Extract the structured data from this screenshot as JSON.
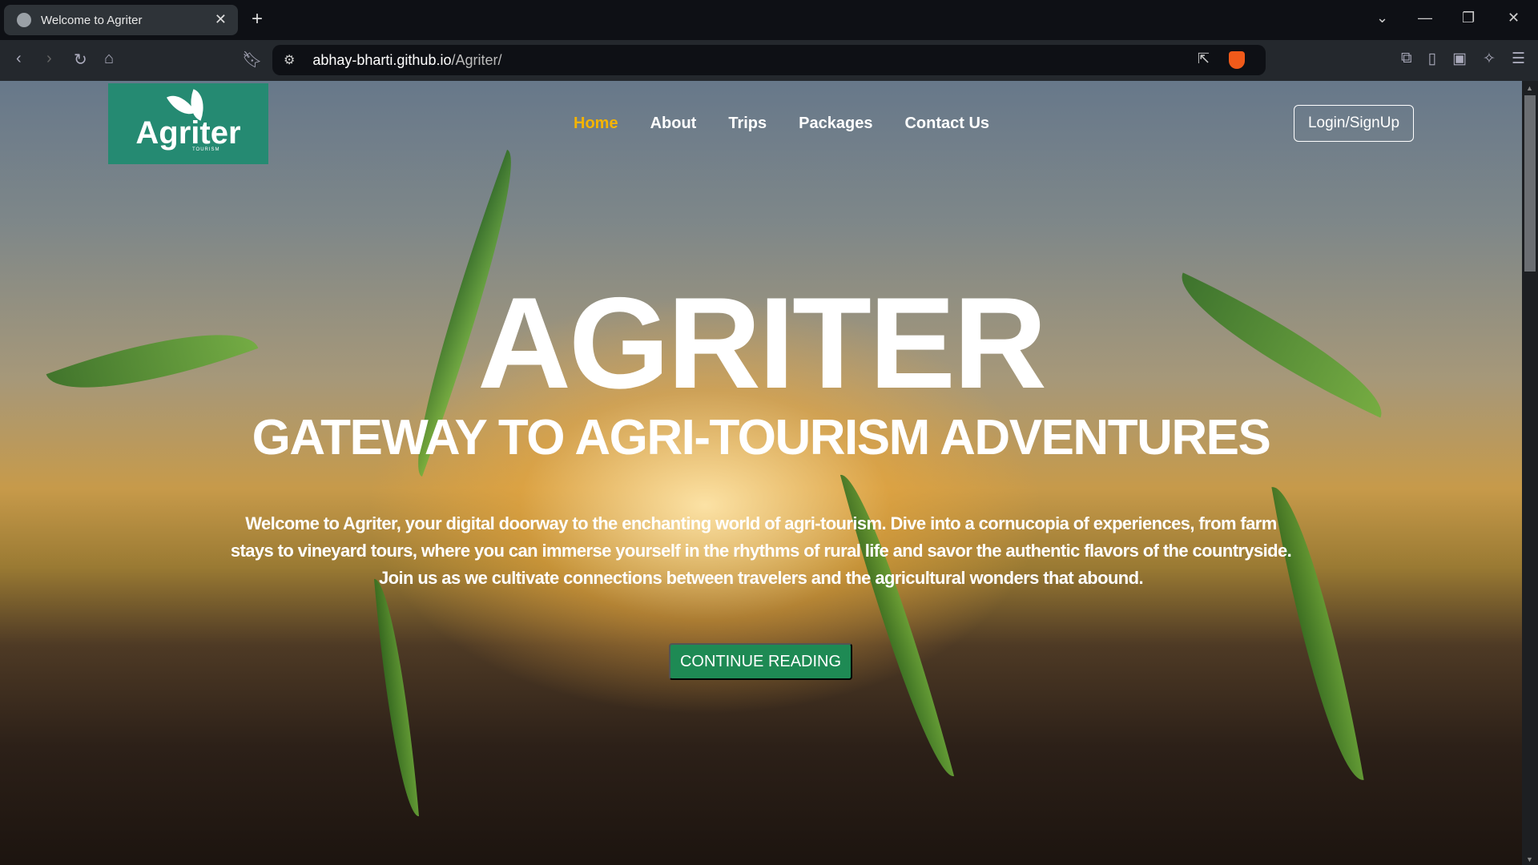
{
  "browser": {
    "tab_title": "Welcome to Agriter",
    "url_host": "abhay-bharti.github.io",
    "url_path": "/Agriter/"
  },
  "logo": {
    "brand": "Agriter",
    "tagline": "TOURISM"
  },
  "nav": {
    "items": [
      {
        "label": "Home",
        "active": true
      },
      {
        "label": "About"
      },
      {
        "label": "Trips"
      },
      {
        "label": "Packages"
      },
      {
        "label": "Contact Us"
      }
    ],
    "login_label": "Login/SignUp"
  },
  "hero": {
    "title": "AGRITER",
    "subtitle": "GATEWAY TO AGRI-TOURISM ADVENTURES",
    "paragraph_lines": [
      "Welcome to Agriter, your digital doorway to the enchanting world of agri-tourism. Dive into a cornucopia of experiences, from farm",
      "stays to vineyard tours, where you can immerse yourself in the rhythms of rural life and savor the authentic flavors of the countryside.",
      "Join us as we cultivate connections between travelers and the agricultural wonders that abound."
    ],
    "cta_label": "CONTINUE READING"
  },
  "colors": {
    "accent": "#f5b400",
    "brand": "#258a72",
    "cta": "#1e8a54"
  }
}
